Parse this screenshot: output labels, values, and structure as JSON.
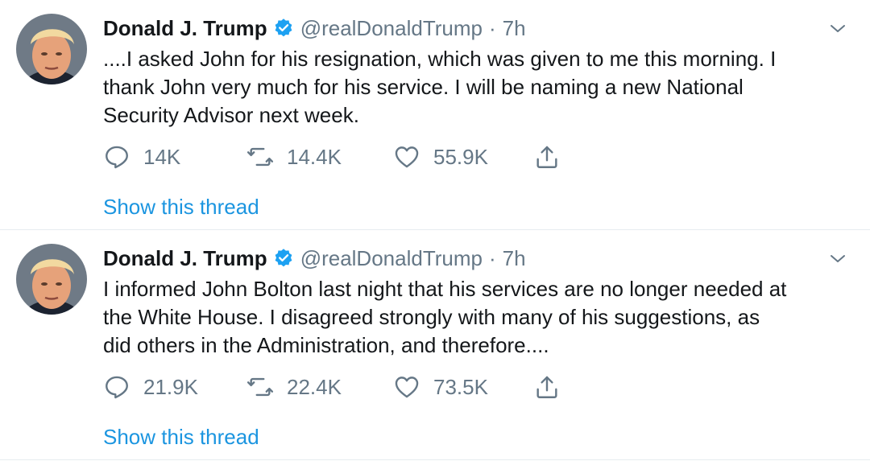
{
  "tweets": [
    {
      "name": "Donald J. Trump",
      "handle": "@realDonaldTrump",
      "separator": "·",
      "time": "7h",
      "text_lines": [
        "....I asked John for his resignation, which was given to me this morning. I",
        "thank John very much for his service. I will be naming a new National",
        "Security Advisor next week."
      ],
      "replies": "14K",
      "retweets": "14.4K",
      "likes": "55.9K",
      "show_thread": "Show this thread"
    },
    {
      "name": "Donald J. Trump",
      "handle": "@realDonaldTrump",
      "separator": "·",
      "time": "7h",
      "text_lines": [
        "I informed John Bolton last night that his services are no longer needed at",
        "the White House. I disagreed strongly with many of his suggestions, as",
        "did others in the Administration, and therefore...."
      ],
      "replies": "21.9K",
      "retweets": "22.4K",
      "likes": "73.5K",
      "show_thread": "Show this thread"
    }
  ],
  "icons": {
    "verified": "verified-badge-icon",
    "caret": "chevron-down-icon",
    "reply": "reply-icon",
    "retweet": "retweet-icon",
    "like": "heart-icon",
    "share": "share-icon"
  },
  "colors": {
    "accent": "#1b95e0",
    "verified": "#1da1f2",
    "secondary_text": "#657786",
    "primary_text": "#14171a",
    "divider": "#e6ecf0"
  }
}
